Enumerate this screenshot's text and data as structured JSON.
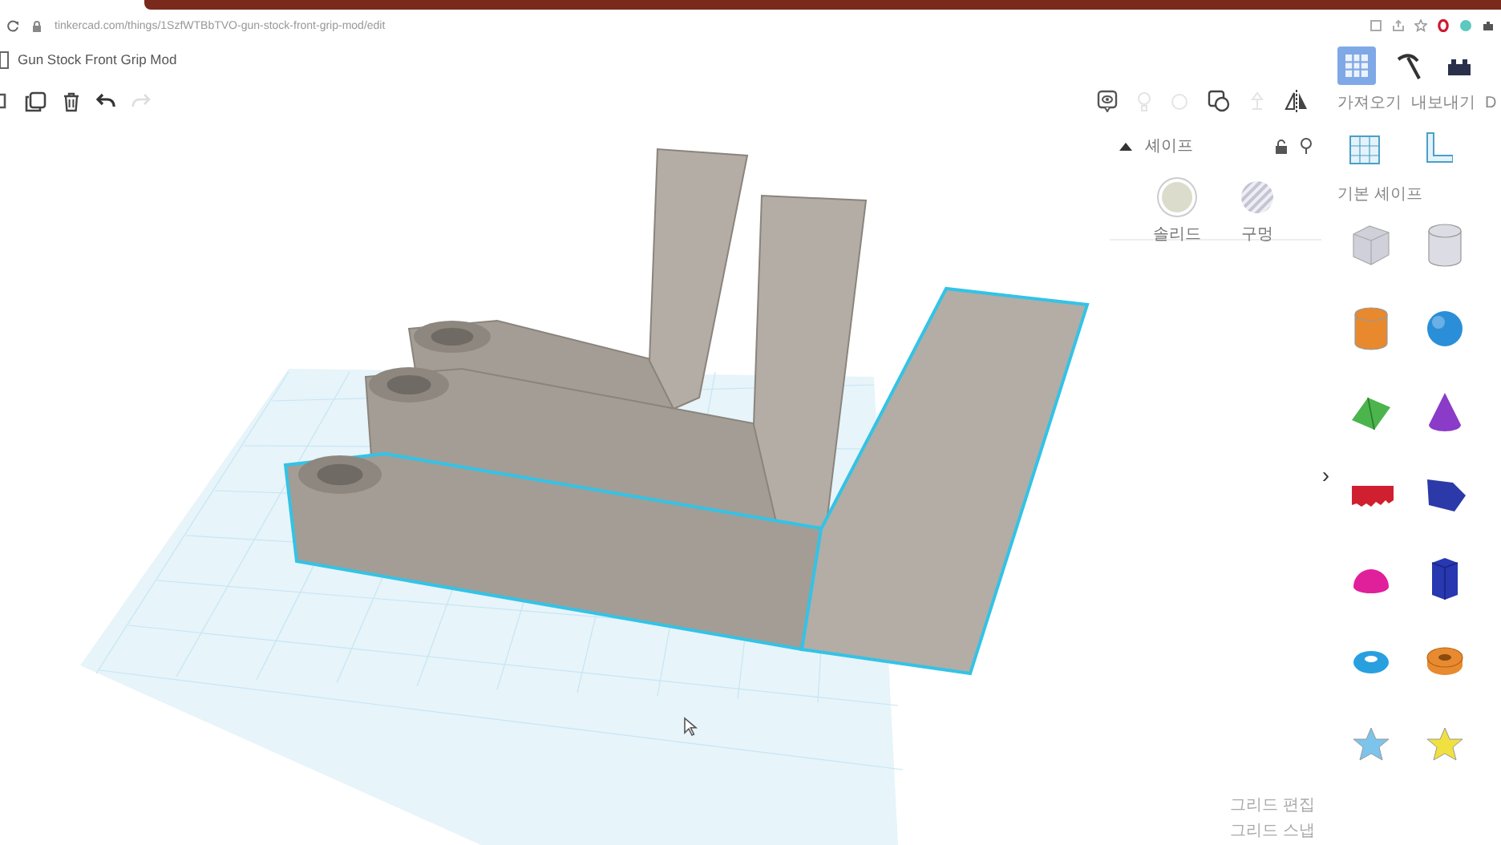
{
  "browser": {
    "url": "tinkercad.com/things/1SzfWTBbTVO-gun-stock-front-grip-mod/edit"
  },
  "design": {
    "title": "Gun Stock Front Grip Mod"
  },
  "view_modes": [
    {
      "kind": "grid",
      "selected": true
    },
    {
      "kind": "pickaxe",
      "selected": false
    },
    {
      "kind": "bricks",
      "selected": false
    }
  ],
  "top_actions": [
    {
      "label": "가져오기"
    },
    {
      "label": "내보내기"
    },
    {
      "label": "D"
    }
  ],
  "inspector": {
    "title": "셰이프",
    "options": [
      {
        "kind": "solid",
        "label": "솔리드"
      },
      {
        "kind": "hole",
        "label": "구멍"
      }
    ]
  },
  "canvas": {
    "models": [
      {
        "selected": false
      },
      {
        "selected": false
      },
      {
        "selected": true
      }
    ],
    "panel_toggle": "›",
    "grid_labels": [
      "그리드 편집",
      "그리드 스냅"
    ]
  },
  "shape_library": {
    "category": "기본 셰이프",
    "shapes": [
      {
        "kind": "box",
        "color": "#cfd0da"
      },
      {
        "kind": "cylinder",
        "color": "#dcdce4"
      },
      {
        "kind": "cylinder",
        "color": "#e8892e"
      },
      {
        "kind": "sphere",
        "color": "#2a8fd8"
      },
      {
        "kind": "roof",
        "color": "#4cb44c"
      },
      {
        "kind": "cone",
        "color": "#8a3cc8"
      },
      {
        "kind": "text",
        "color": "#d02030"
      },
      {
        "kind": "polygon",
        "color": "#2b3aa8"
      },
      {
        "kind": "halfsphere",
        "color": "#e0209a"
      },
      {
        "kind": "prism",
        "color": "#2838b0"
      },
      {
        "kind": "torus",
        "color": "#28a0e0"
      },
      {
        "kind": "tube",
        "color": "#e88a30"
      },
      {
        "kind": "star",
        "color": "#7cc4ec"
      },
      {
        "kind": "star",
        "color": "#f0e040"
      }
    ]
  }
}
